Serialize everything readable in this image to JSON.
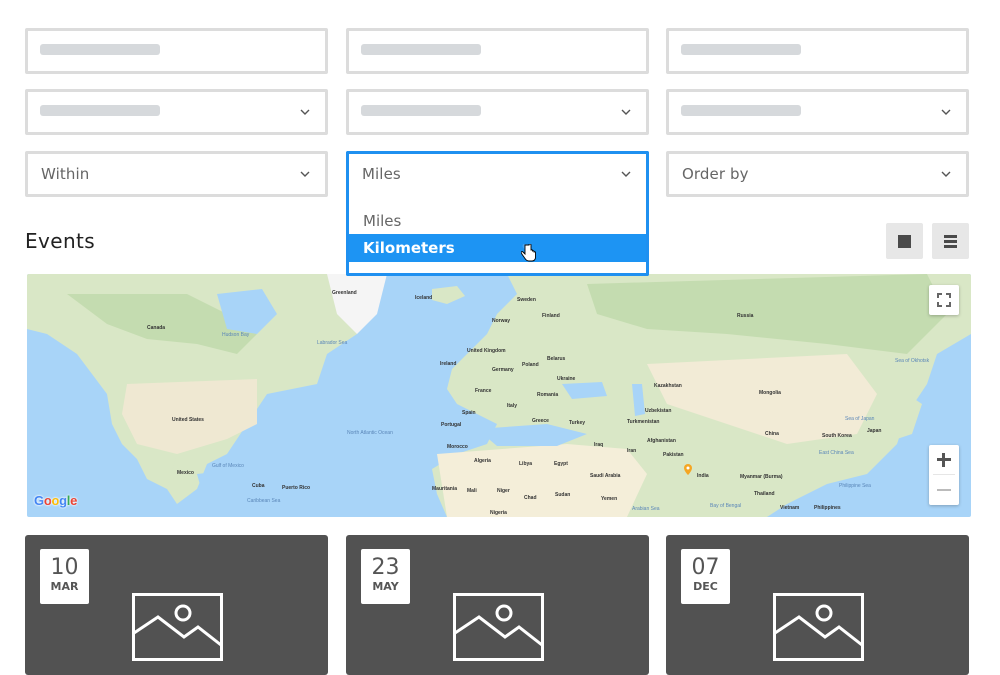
{
  "filters": {
    "row1": [
      {
        "type": "text",
        "placeholder": ""
      },
      {
        "type": "text",
        "placeholder": ""
      },
      {
        "type": "text",
        "placeholder": ""
      }
    ],
    "row2": [
      {
        "type": "select",
        "value": ""
      },
      {
        "type": "select",
        "value": ""
      },
      {
        "type": "select",
        "value": ""
      }
    ],
    "within": {
      "label": "Within"
    },
    "unit": {
      "value": "Miles",
      "open": true,
      "options": [
        {
          "label": "Miles",
          "selected": false
        },
        {
          "label": "Kilometers",
          "selected": true
        }
      ]
    },
    "order_by": {
      "label": "Order by"
    }
  },
  "section": {
    "title": "Events",
    "view_buttons": [
      {
        "name": "grid-view",
        "icon": "square-icon"
      },
      {
        "name": "list-view",
        "icon": "list-icon"
      }
    ]
  },
  "map": {
    "provider_logo": "Google",
    "controls": {
      "fullscreen": "fullscreen-icon",
      "zoom_in": "+",
      "zoom_out": "−"
    },
    "labels": {
      "canada": "Canada",
      "united_states": "United States",
      "mexico": "Mexico",
      "hudson_bay": "Hudson Bay",
      "gulf_of_mexico": "Gulf of Mexico",
      "cuba": "Cuba",
      "puerto_rico": "Puerto Rico",
      "caribbean_sea": "Caribbean Sea",
      "greenland": "Greenland",
      "iceland": "Iceland",
      "labrador_sea": "Labrador Sea",
      "north_atlantic": "North Atlantic Ocean",
      "sweden": "Sweden",
      "finland": "Finland",
      "norway": "Norway",
      "uk": "United Kingdom",
      "ireland": "Ireland",
      "germany": "Germany",
      "poland": "Poland",
      "belarus": "Belarus",
      "ukraine": "Ukraine",
      "france": "France",
      "romania": "Romania",
      "spain": "Spain",
      "portugal": "Portugal",
      "italy": "Italy",
      "greece": "Greece",
      "turkey": "Turkey",
      "morocco": "Morocco",
      "algeria": "Algeria",
      "libya": "Libya",
      "egypt": "Egypt",
      "saudi_arabia": "Saudi Arabia",
      "iraq": "Iraq",
      "iran": "Iran",
      "mali": "Mali",
      "niger": "Niger",
      "chad": "Chad",
      "sudan": "Sudan",
      "mauritania": "Mauritania",
      "yemen": "Yemen",
      "nigeria": "Nigeria",
      "russia": "Russia",
      "kazakhstan": "Kazakhstan",
      "mongolia": "Mongolia",
      "uzbekistan": "Uzbekistan",
      "turkmenistan": "Turkmenistan",
      "afghanistan": "Afghanistan",
      "pakistan": "Pakistan",
      "india": "India",
      "china": "China",
      "south_korea": "South Korea",
      "japan": "Japan",
      "myanmar": "Myanmar (Burma)",
      "thailand": "Thailand",
      "vietnam": "Vietnam",
      "philippines": "Philippines",
      "sea_of_okhotsk": "Sea of Okhotsk",
      "sea_of_japan": "Sea of Japan",
      "east_china_sea": "East China Sea",
      "philippine_sea": "Philippine Sea",
      "arabian_sea": "Arabian Sea",
      "bay_of_bengal": "Bay of Bengal"
    },
    "marker_color": "#f5a623"
  },
  "events": [
    {
      "day": "10",
      "month": "MAR"
    },
    {
      "day": "23",
      "month": "MAY"
    },
    {
      "day": "07",
      "month": "DEC"
    }
  ],
  "colors": {
    "accent": "#1d94f3",
    "field_border": "#dcdcdc",
    "card_bg": "#525252"
  }
}
